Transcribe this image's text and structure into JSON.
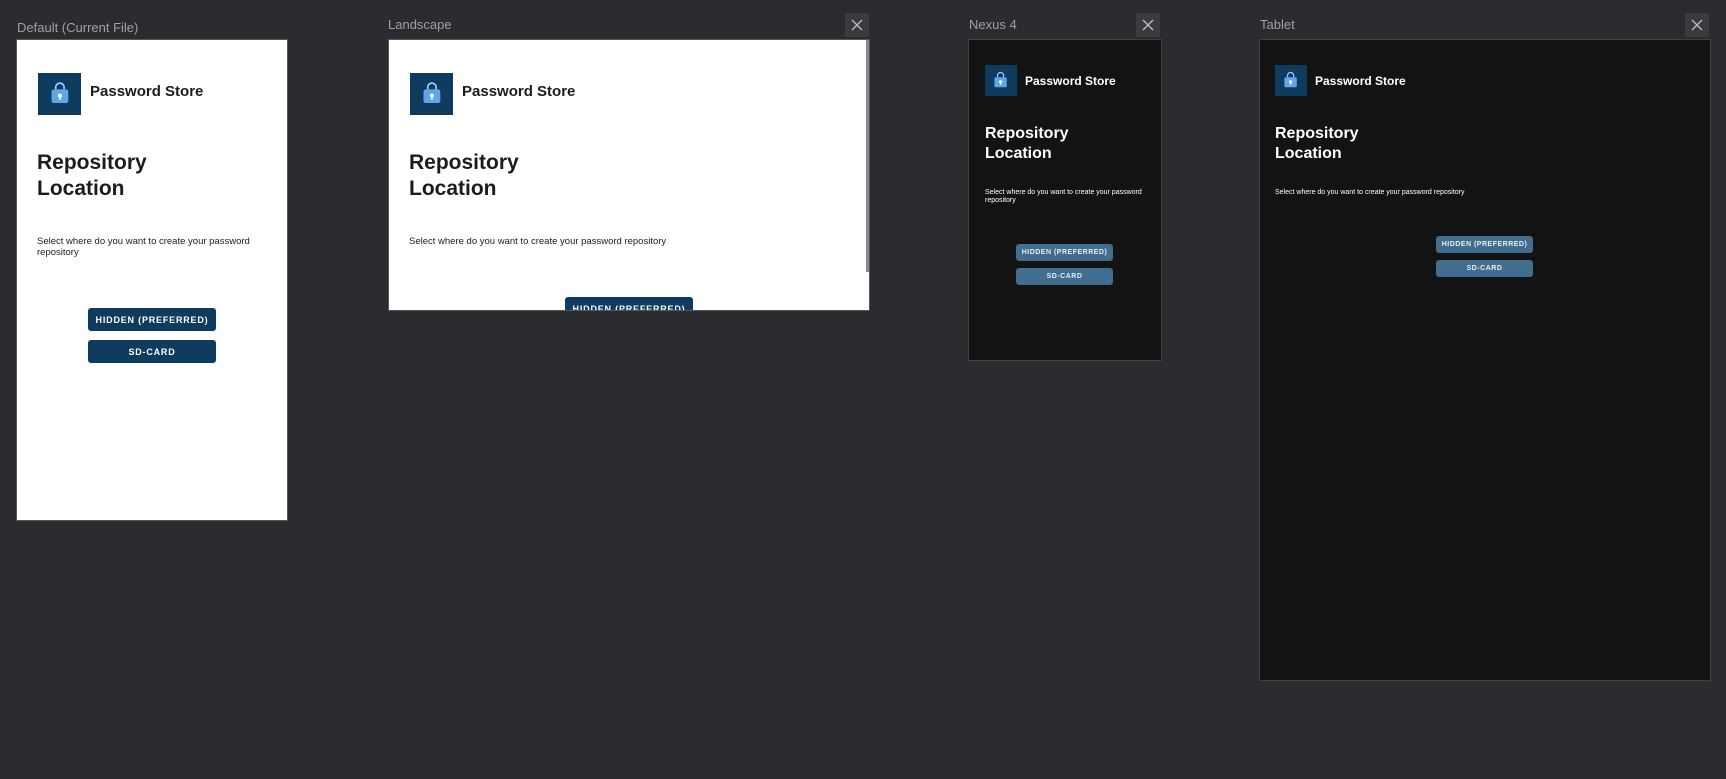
{
  "previews": [
    {
      "label": "Default (Current File)",
      "closable": false,
      "theme": "light",
      "app_name": "Password Store",
      "heading": "Repository Location",
      "description": "Select where do you want to create your password repository",
      "buttons": [
        "HIDDEN (PREFERRED)",
        "SD-CARD"
      ]
    },
    {
      "label": "Landscape",
      "closable": true,
      "theme": "light",
      "app_name": "Password Store",
      "heading": "Repository Location",
      "description": "Select where do you want to create your password repository",
      "buttons": [
        "HIDDEN (PREFERRED)"
      ]
    },
    {
      "label": "Nexus 4",
      "closable": true,
      "theme": "dark",
      "app_name": "Password Store",
      "heading": "Repository Location",
      "description": "Select where do you want to create your password repository",
      "buttons": [
        "HIDDEN (PREFERRED)",
        "SD-CARD"
      ]
    },
    {
      "label": "Tablet",
      "closable": true,
      "theme": "dark",
      "app_name": "Password Store",
      "heading": "Repository Location",
      "description": "Select where do you want to create your password repository",
      "buttons": [
        "HIDDEN (PREFERRED)",
        "SD-CARD"
      ]
    }
  ],
  "icons": {
    "close": "close-icon",
    "app": "lock-bag-icon"
  },
  "colors": {
    "background": "#2b2c2f",
    "accent_light_theme": "#0e3b5e",
    "accent_dark_theme": "#416d8f",
    "dark_surface": "#131313"
  }
}
